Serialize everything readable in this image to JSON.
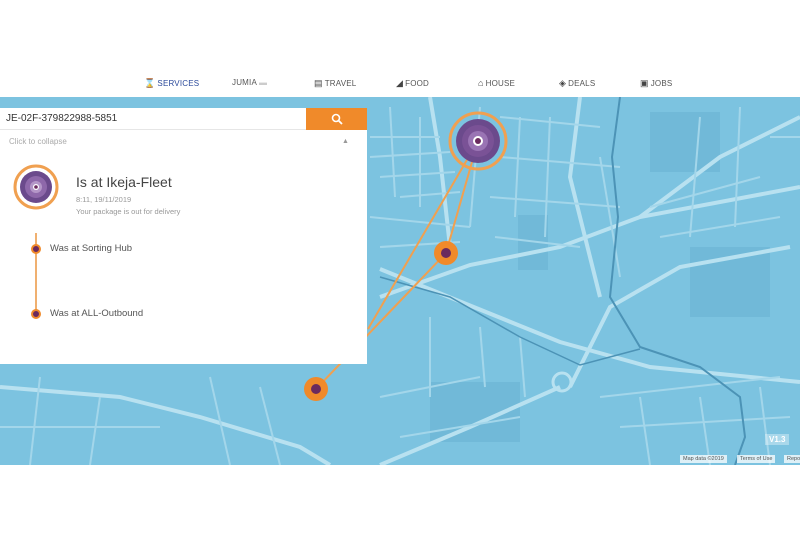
{
  "nav": {
    "services": "SERVICES",
    "jumia": "JUMIA",
    "travel": "TRAVEL",
    "food": "FOOD",
    "house": "HOUSE",
    "deals": "DEALS",
    "jobs": "JOBS"
  },
  "search": {
    "value": "JE-02F-379822988-5851"
  },
  "panel": {
    "collapse_label": "Click to collapse",
    "current_status": "Is at Ikeja-Fleet",
    "current_time": "8:11, 19/11/2019",
    "current_description": "Your package is out for delivery",
    "history": [
      "Was at Sorting Hub",
      "Was at ALL-Outbound"
    ]
  },
  "map": {
    "version": "V1.3",
    "attribution": [
      "Map data ©2019",
      "Terms of Use",
      "Report a map error"
    ]
  },
  "colors": {
    "accent": "#f08a2a",
    "marker": "#6b2a5e",
    "water": "#7cc3e0"
  }
}
